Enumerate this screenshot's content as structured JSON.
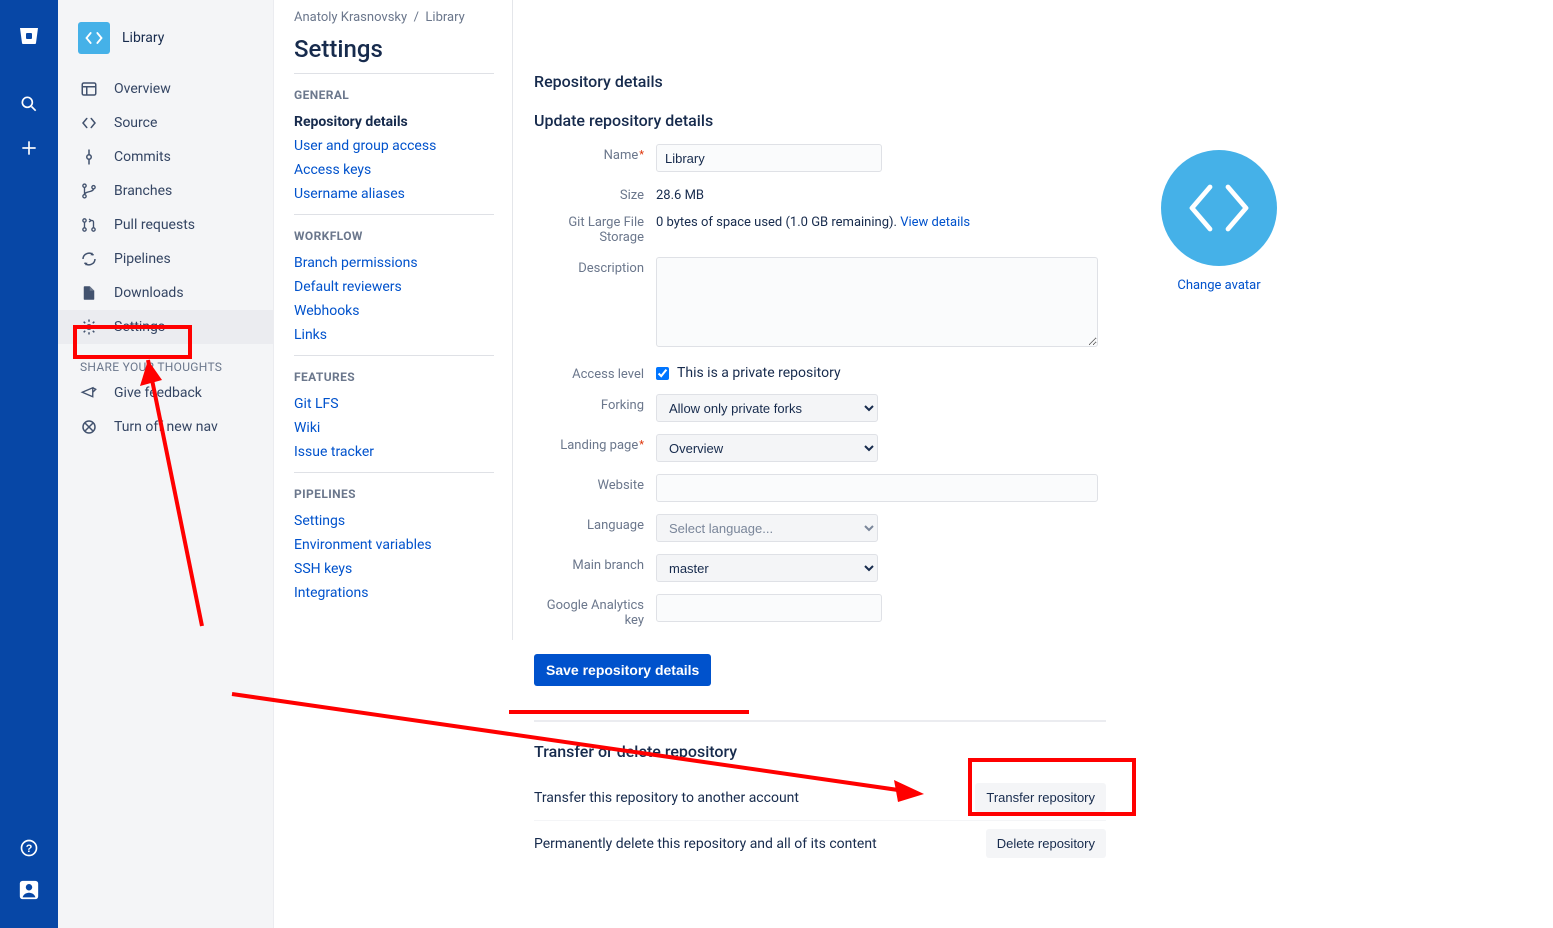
{
  "global": {
    "logo": "bitbucket-logo",
    "search_icon": "search-icon",
    "plus_icon": "plus-icon",
    "help_icon": "help-icon",
    "profile_icon": "profile-icon"
  },
  "repo": {
    "name": "Library",
    "nav": [
      {
        "icon": "overview-icon",
        "label": "Overview"
      },
      {
        "icon": "source-icon",
        "label": "Source"
      },
      {
        "icon": "commits-icon",
        "label": "Commits"
      },
      {
        "icon": "branches-icon",
        "label": "Branches"
      },
      {
        "icon": "pull-requests-icon",
        "label": "Pull requests"
      },
      {
        "icon": "pipelines-icon",
        "label": "Pipelines"
      },
      {
        "icon": "downloads-icon",
        "label": "Downloads"
      },
      {
        "icon": "settings-icon",
        "label": "Settings"
      }
    ],
    "share_heading": "Share your thoughts",
    "share_items": [
      {
        "icon": "feedback-icon",
        "label": "Give feedback"
      },
      {
        "icon": "turnoff-icon",
        "label": "Turn off new nav"
      }
    ]
  },
  "breadcrumb": {
    "owner": "Anatoly Krasnovsky",
    "repo": "Library"
  },
  "page_title": "Settings",
  "settings_nav": {
    "general": {
      "heading": "GENERAL",
      "items": [
        "Repository details",
        "User and group access",
        "Access keys",
        "Username aliases"
      ],
      "active": "Repository details"
    },
    "workflow": {
      "heading": "WORKFLOW",
      "items": [
        "Branch permissions",
        "Default reviewers",
        "Webhooks",
        "Links"
      ]
    },
    "features": {
      "heading": "FEATURES",
      "items": [
        "Git LFS",
        "Wiki",
        "Issue tracker"
      ]
    },
    "pipelines": {
      "heading": "PIPELINES",
      "items": [
        "Settings",
        "Environment variables",
        "SSH keys",
        "Integrations"
      ]
    }
  },
  "details": {
    "heading": "Repository details",
    "sub_heading": "Update repository details",
    "labels": {
      "name": "Name",
      "size": "Size",
      "lfs": "Git Large File Storage",
      "description": "Description",
      "access": "Access level",
      "forking": "Forking",
      "landing": "Landing page",
      "website": "Website",
      "language": "Language",
      "main_branch": "Main branch",
      "ga_key": "Google Analytics key"
    },
    "values": {
      "name": "Library",
      "size": "28.6 MB",
      "lfs_text": "0 bytes of space used (1.0 GB remaining). ",
      "lfs_link": "View details",
      "access_checkbox_label": "This is a private repository",
      "access_checked": true,
      "forking": "Allow only private forks",
      "landing": "Overview",
      "website": "",
      "language_placeholder": "Select language...",
      "main_branch": "master",
      "ga_key": ""
    },
    "save_button": "Save repository details"
  },
  "transfer_delete": {
    "heading": "Transfer or delete repository",
    "transfer_text": "Transfer this repository to another account",
    "transfer_button": "Transfer repository",
    "delete_text": "Permanently delete this repository and all of its content",
    "delete_button": "Delete repository"
  },
  "avatar": {
    "change_link": "Change avatar"
  }
}
